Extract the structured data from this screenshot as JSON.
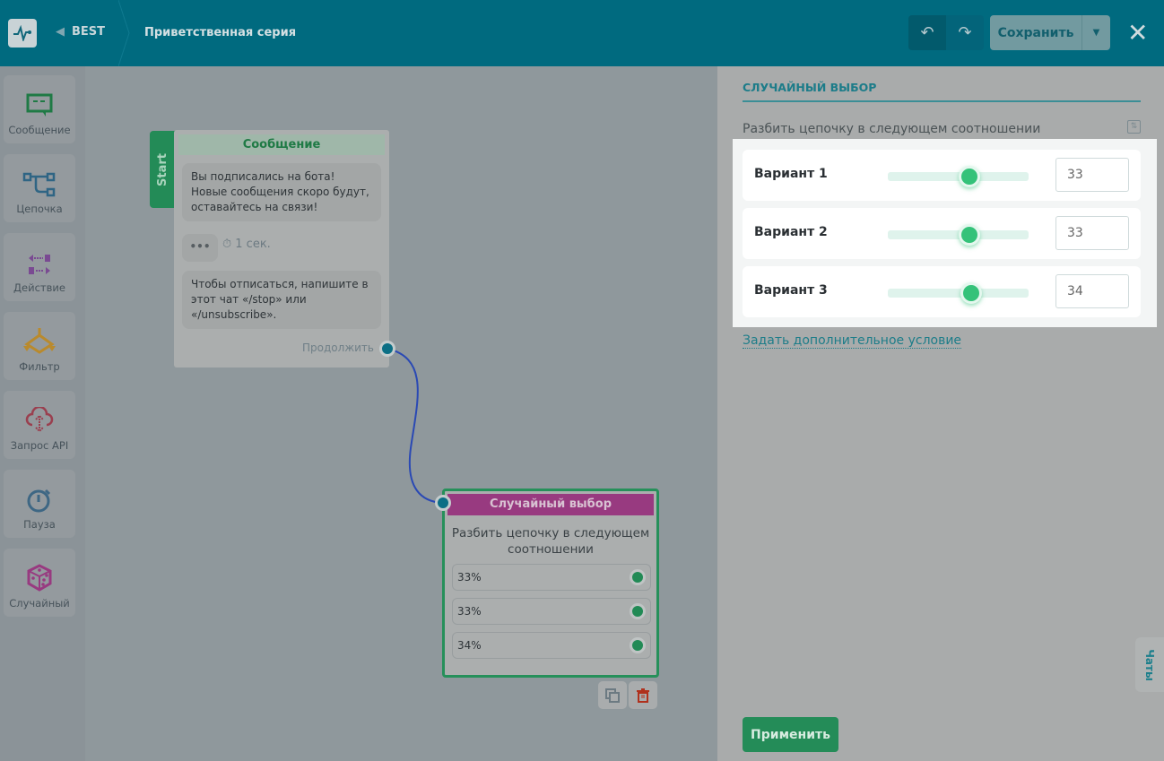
{
  "header": {
    "bot_name": "BEST",
    "flow_title": "Приветственная серия",
    "save_label": "Сохранить"
  },
  "sidebar": {
    "items": [
      {
        "label": "Сообщение",
        "icon": "message-icon",
        "color": "#1f7a45"
      },
      {
        "label": "Цепочка",
        "icon": "chain-icon",
        "color": "#2f6584"
      },
      {
        "label": "Действие",
        "icon": "action-icon",
        "color": "#7a4a92"
      },
      {
        "label": "Фильтр",
        "icon": "filter-icon",
        "color": "#b98a2d"
      },
      {
        "label": "Запрос API",
        "icon": "cloud-api-icon",
        "color": "#9a3f4f"
      },
      {
        "label": "Пауза",
        "icon": "stopwatch-icon",
        "color": "#3e6784"
      },
      {
        "label": "Случайный",
        "icon": "dice-icon",
        "color": "#983a80"
      }
    ]
  },
  "canvas": {
    "start_label": "Start",
    "message_node": {
      "title": "Сообщение",
      "text1": "Вы подписались на бота! Новые сообщения скоро будут, оставайтесь на связи!",
      "dots": "•••",
      "delay": "1 сек.",
      "text2": "Чтобы отписаться, напишите в этот чат «/stop» или «/unsubscribe».",
      "continue": "Продолжить"
    },
    "random_node": {
      "title": "Случайный выбор",
      "description": "Разбить цепочку в следующем соотношении",
      "options": [
        "33%",
        "33%",
        "34%"
      ]
    }
  },
  "panel": {
    "title": "СЛУЧАЙНЫЙ ВЫБОР",
    "subtitle": "Разбить цепочку в следующем соотношении",
    "variants": [
      {
        "label": "Вариант 1",
        "value": "33",
        "fraction": 0.33
      },
      {
        "label": "Вариант 2",
        "value": "33",
        "fraction": 0.33
      },
      {
        "label": "Вариант 3",
        "value": "34",
        "fraction": 0.34
      }
    ],
    "add_condition": "Задать дополнительное условие",
    "apply": "Применить"
  },
  "chats_tab": "Чаты"
}
